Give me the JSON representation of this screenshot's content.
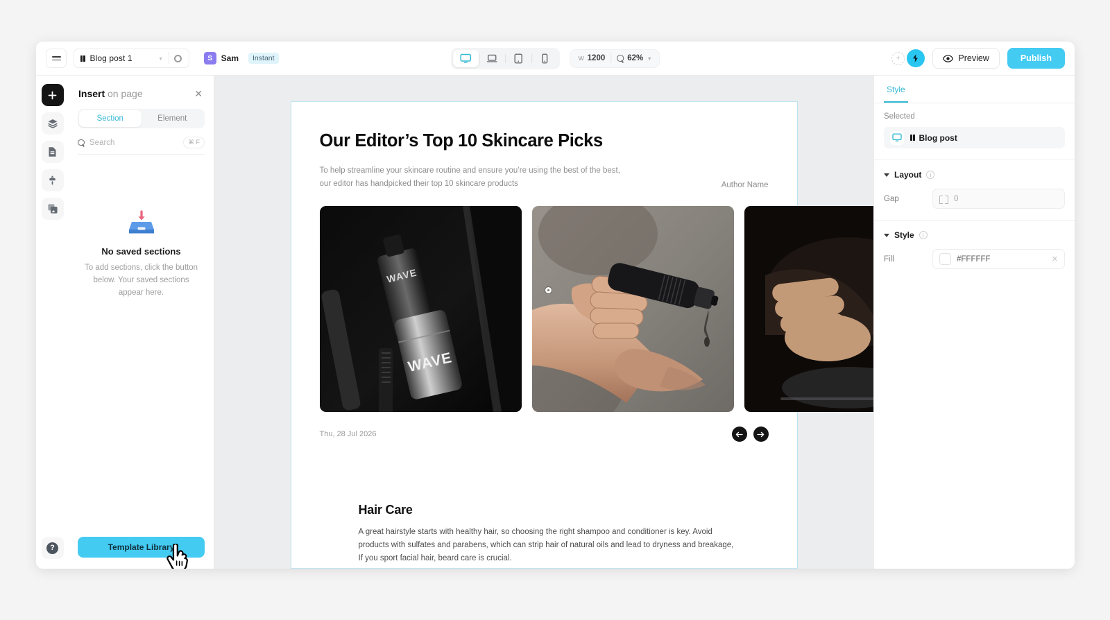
{
  "topbar": {
    "menu_icon": "hamburger-icon",
    "doc_name": "Blog post 1",
    "doc_caret": "▾",
    "settings_icon": "gear-icon",
    "user_initial": "S",
    "user_name": "Sam",
    "status_badge": "Instant",
    "devices": [
      {
        "name": "desktop",
        "active": true
      },
      {
        "name": "laptop",
        "active": false
      },
      {
        "name": "tablet",
        "active": false
      },
      {
        "name": "mobile",
        "active": false
      }
    ],
    "width_label": "w",
    "width_value": "1200",
    "zoom_value": "62%",
    "zoom_caret": "▾",
    "add_collaborator": "+",
    "preview_label": "Preview",
    "publish_label": "Publish",
    "accent_cyan": "#44cbf2",
    "avatar_purple": "#8b7cf0"
  },
  "rail": {
    "items": [
      {
        "icon": "plus-icon",
        "active": true
      },
      {
        "icon": "layers-icon",
        "active": false
      },
      {
        "icon": "pages-icon",
        "active": false
      },
      {
        "icon": "theme-brush-icon",
        "active": false
      },
      {
        "icon": "assets-icon",
        "active": false
      }
    ],
    "help_label": "?"
  },
  "insert_panel": {
    "title_strong": "Insert",
    "title_light": " on page",
    "close_icon": "close-icon",
    "tabs": [
      {
        "label": "Section",
        "active": true
      },
      {
        "label": "Element",
        "active": false
      }
    ],
    "search_placeholder": "Search",
    "search_shortcut": "⌘ F",
    "empty_icon": "saved-sections-inbox-icon",
    "empty_title": "No saved sections",
    "empty_desc": "To add sections, click the button below. Your saved sections appear here.",
    "template_button": "Template Library"
  },
  "canvas": {
    "hero": {
      "title": "Our Editor’s Top 10 Skincare Picks",
      "subtitle": "To help streamline your skincare routine and ensure you’re using the best of the best, our editor has handpicked their top 10 skincare products",
      "author": "Author Name",
      "date": "Thu, 28 Jul 2026",
      "prev_icon": "arrow-left-icon",
      "next_icon": "arrow-right-icon",
      "cards": [
        {
          "alt": "black WAVE serum bottles on dark background",
          "label": "WAVE"
        },
        {
          "alt": "hand pouring serum from black dropper bottle"
        },
        {
          "alt": "dark close-up of hands with product"
        }
      ]
    },
    "hair_section": {
      "title": "Hair Care",
      "body": "A great hairstyle starts with healthy hair, so choosing the right shampoo and conditioner is key. Avoid products with sulfates and parabens, which can strip hair of natural oils and lead to dryness and breakage, If you sport facial hair, beard care is crucial."
    }
  },
  "right_panel": {
    "tab_style": "Style",
    "selected_label": "Selected",
    "selected_item": "Blog post",
    "layout": {
      "title": "Layout",
      "gap_label": "Gap",
      "gap_value": "0"
    },
    "style": {
      "title": "Style",
      "fill_label": "Fill",
      "fill_value": "#FFFFFF"
    }
  }
}
